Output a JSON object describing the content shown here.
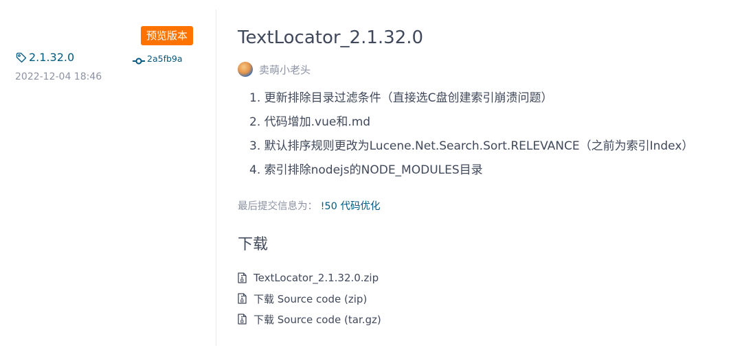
{
  "release": {
    "badge": "预览版本",
    "tag": "2.1.32.0",
    "commit": "2a5fb9a",
    "date": "2022-12-04 18:46",
    "title": "TextLocator_2.1.32.0",
    "author": "卖萌小老头",
    "notes": [
      "1. 更新排除目录过滤条件（直接选C盘创建索引崩溃问题）",
      "2. 代码增加.vue和.md",
      "3. 默认排序规则更改为Lucene.Net.Search.Sort.RELEVANCE（之前为索引Index）",
      "4. 索引排除nodejs的NODE_MODULES目录"
    ],
    "last_commit_label": "最后提交信息为：",
    "last_commit_link": "!50 代码优化"
  },
  "downloads": {
    "heading": "下载",
    "items": [
      {
        "label": "TextLocator_2.1.32.0.zip",
        "icon": "zip-file-icon"
      },
      {
        "label": "下载 Source code (zip)",
        "icon": "zip-file-icon"
      },
      {
        "label": "下载 Source code (tar.gz)",
        "icon": "zip-file-icon"
      }
    ]
  },
  "colors": {
    "accent": "#fe7300",
    "link": "#005980",
    "text": "#40485b",
    "muted": "#8c92a4"
  }
}
